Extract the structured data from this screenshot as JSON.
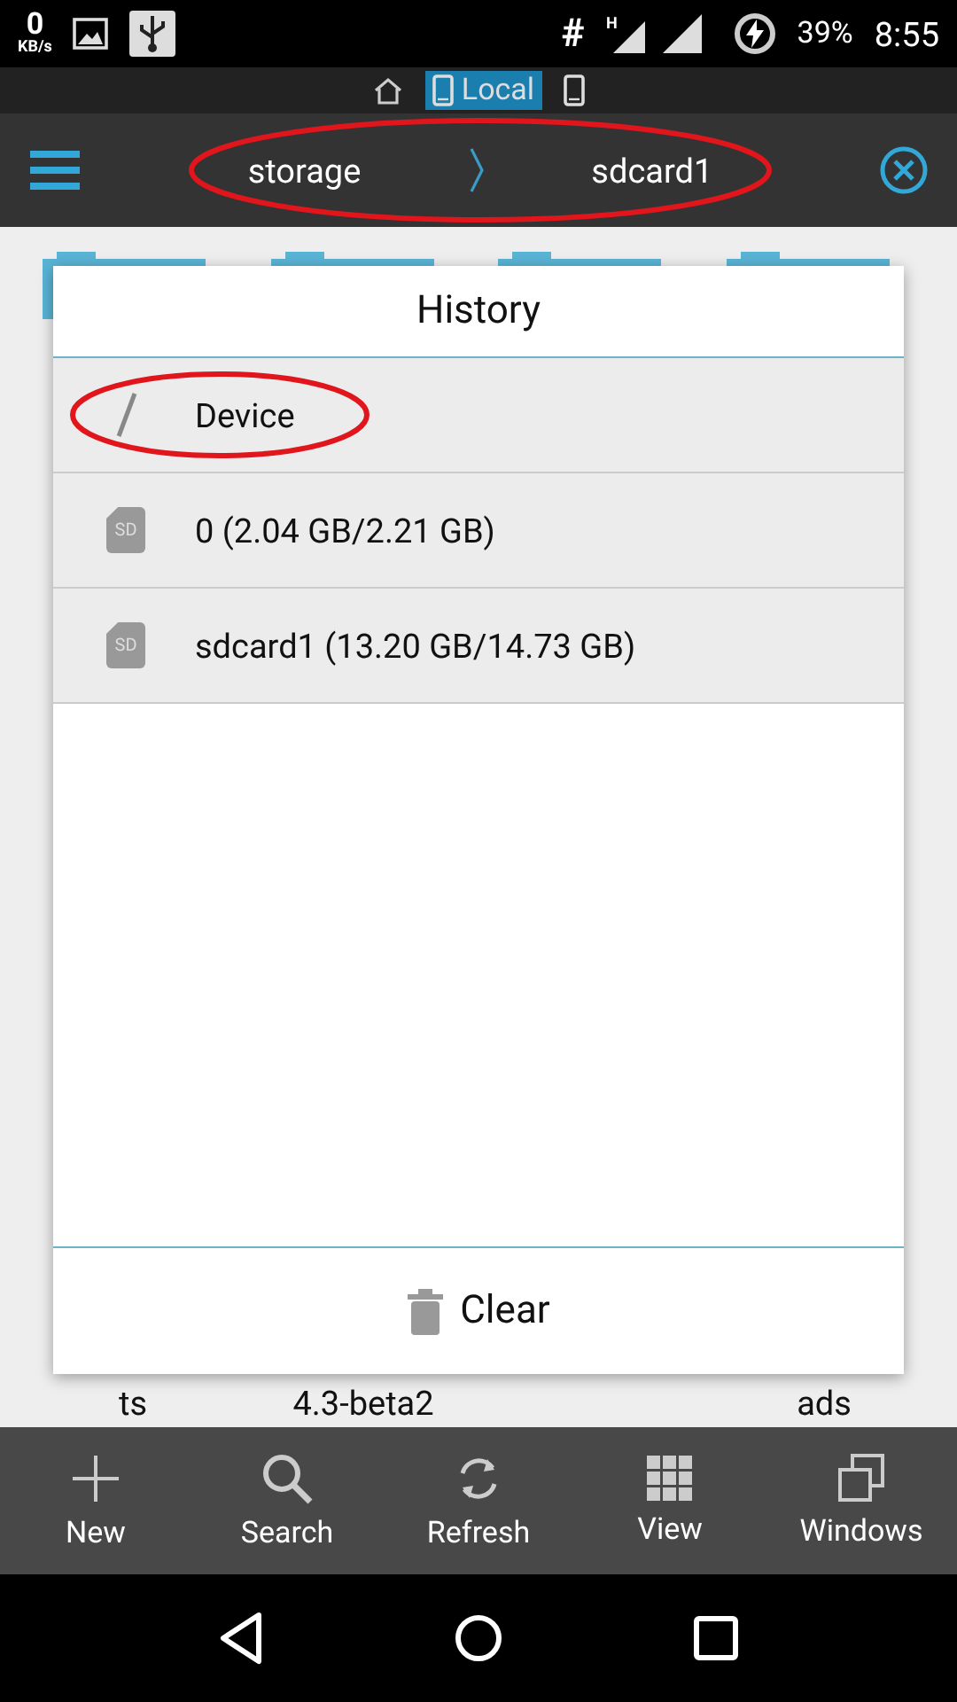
{
  "status_bar": {
    "speed": "0",
    "speed_unit": "KB/s",
    "hash": "#",
    "network": "H",
    "battery": "39%",
    "time": "8:55"
  },
  "location_tabs": [
    {
      "kind": "home",
      "selected": false
    },
    {
      "kind": "local",
      "label": "Local",
      "selected": true
    },
    {
      "kind": "device",
      "selected": false
    }
  ],
  "breadcrumb": [
    "storage",
    "sdcard1"
  ],
  "folders": [
    {
      "kind": "folder",
      "name": "ts"
    },
    {
      "kind": "folder",
      "name": "4.3-beta2"
    },
    {
      "kind": "folder"
    },
    {
      "kind": "folder",
      "name": "ads"
    }
  ],
  "dialog": {
    "title": "History",
    "items": [
      {
        "kind": "root",
        "label": "Device",
        "circled": true
      },
      {
        "kind": "sd",
        "icon_text": "SD",
        "label": "0 (2.04 GB/2.21 GB)",
        "circled": false
      },
      {
        "kind": "sd",
        "icon_text": "SD",
        "label": "sdcard1 (13.20 GB/14.73 GB)",
        "circled": false
      }
    ],
    "clear": "Clear"
  },
  "bottom_bar": [
    {
      "kind": "new",
      "label": "New"
    },
    {
      "kind": "search",
      "label": "Search"
    },
    {
      "kind": "refresh",
      "label": "Refresh"
    },
    {
      "kind": "view",
      "label": "View"
    },
    {
      "kind": "windows",
      "label": "Windows"
    }
  ]
}
